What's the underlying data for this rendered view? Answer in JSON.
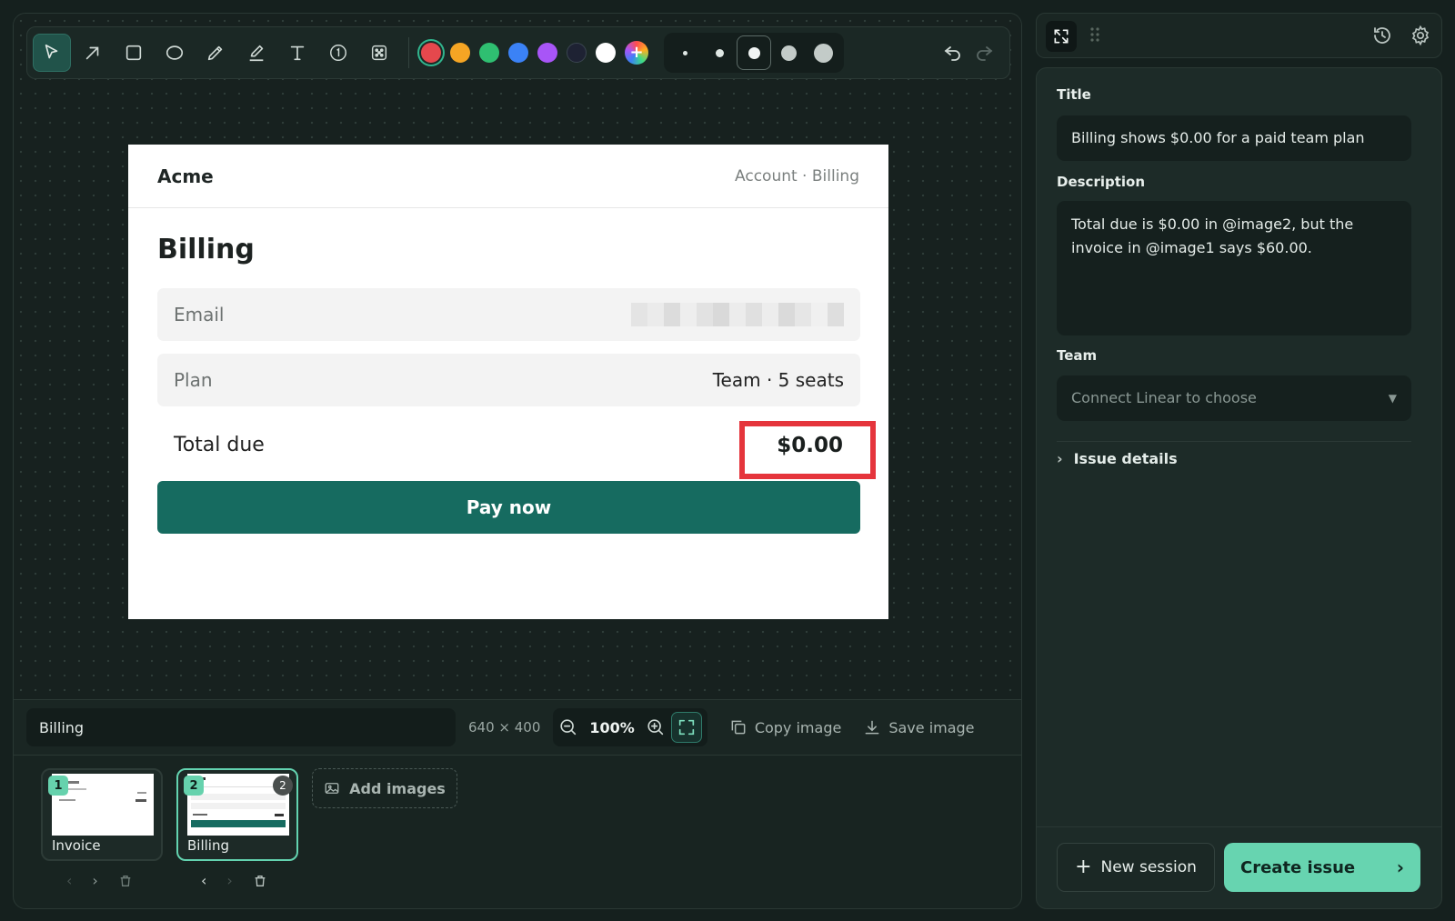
{
  "toolbar": {
    "tools": [
      "select-icon",
      "arrow-icon",
      "rectangle-icon",
      "ellipse-icon",
      "pencil-icon",
      "highlighter-icon",
      "text-icon",
      "step-number-icon",
      "blur-icon"
    ],
    "colors": [
      "#e5484d",
      "#f5a524",
      "#2fbf71",
      "#3b82f6",
      "#a855f7",
      "#1e2233",
      "#ffffff"
    ],
    "selected_color": "#e5484d",
    "sizes": [
      "xs",
      "s",
      "m",
      "l",
      "xl"
    ],
    "selected_size": "m"
  },
  "screenshot": {
    "logo": "Acme",
    "breadcrumb": "Account · Billing",
    "heading": "Billing",
    "email_label": "Email",
    "plan_label": "Plan",
    "plan_value": "Team · 5 seats",
    "total_label": "Total due",
    "total_value": "$0.00",
    "pay_button": "Pay now"
  },
  "bottom": {
    "image_name": "Billing",
    "dimensions": "640 × 400",
    "zoom": "100%",
    "copy_label": "Copy image",
    "save_label": "Save image"
  },
  "thumbnails": [
    {
      "number": "1",
      "label": "Invoice"
    },
    {
      "number": "2",
      "label": "Billing",
      "annotations": "2"
    }
  ],
  "add_images_label": "Add images",
  "form": {
    "title_label": "Title",
    "title_value": "Billing shows $0.00 for a paid team plan",
    "description_label": "Description",
    "description_value": "Total due is $0.00 in @image2, but the invoice in @image1 says $60.00.",
    "team_label": "Team",
    "team_placeholder": "Connect Linear to choose",
    "issue_details_label": "Issue details"
  },
  "footer": {
    "new_session": "New session",
    "create_issue": "Create issue"
  }
}
